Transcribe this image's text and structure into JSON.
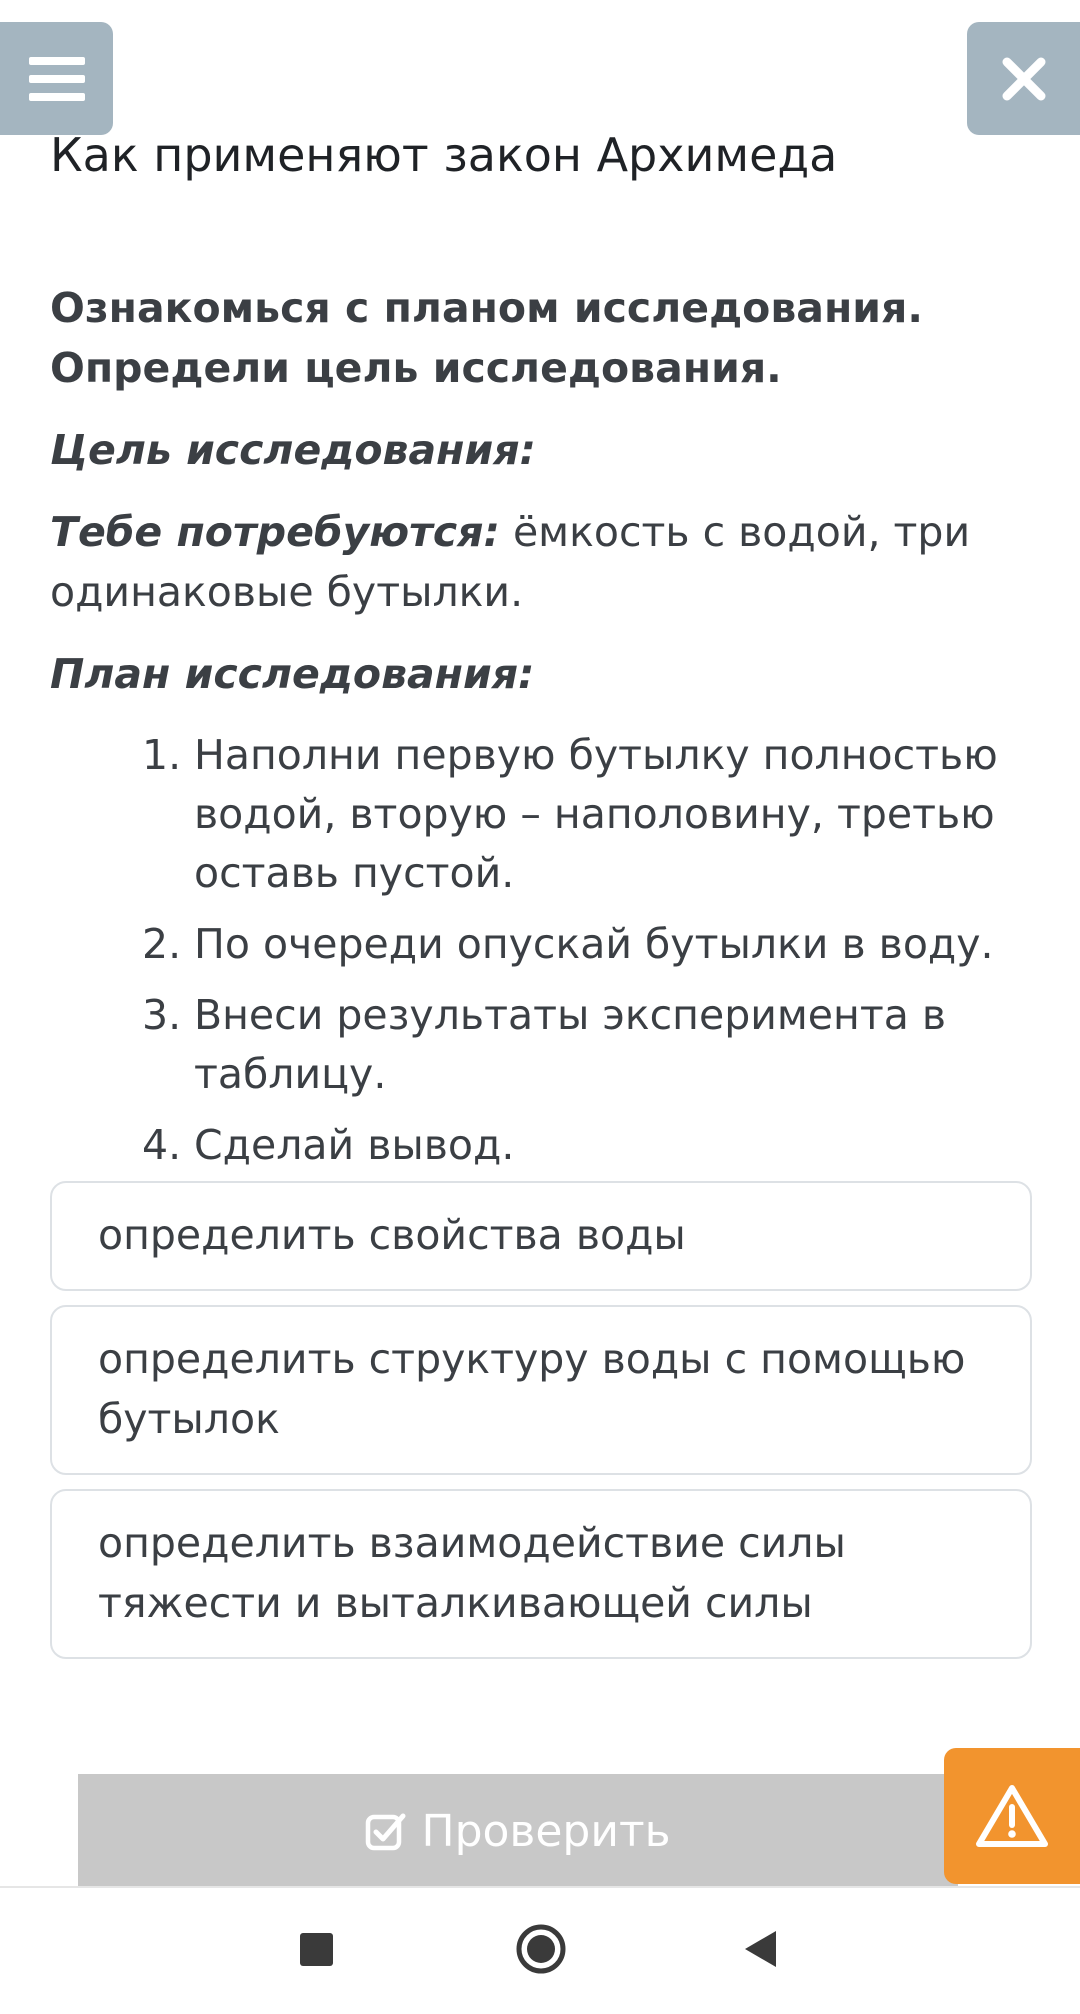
{
  "header": {
    "menu_icon": "hamburger-icon",
    "close_icon": "close-icon",
    "lesson_title": "Как применяют закон Архимеда"
  },
  "task": {
    "line1": "Ознакомься с планом исследования.",
    "line2": "Определи цель исследования.",
    "goal_label": "Цель исследования:",
    "need_label": "Тебе потребуются:",
    "need_text": " ёмкость с водой, три одинаковые бутылки.",
    "plan_label": "План исследования:",
    "plan_steps": [
      {
        "num": "1.",
        "text": "Наполни первую бутылку полностью водой, вторую – наполовину, третью оставь пустой."
      },
      {
        "num": "2.",
        "text": "По очереди опускай бутылки в воду."
      },
      {
        "num": "3.",
        "text": "Внеси результаты эксперимента в таблицу."
      },
      {
        "num": "4.",
        "text": "Сделай вывод."
      }
    ]
  },
  "options": [
    "определить свойства воды",
    "определить структуру воды с помощью бутылок",
    "определить взаимодействие силы тяжести и выталкивающей силы"
  ],
  "footer": {
    "check_label": "Проверить",
    "check_icon": "checkbox-icon",
    "warning_icon": "warning-icon"
  },
  "navbar": {
    "recent_icon": "square-icon",
    "home_icon": "circle-icon",
    "back_icon": "triangle-back-icon"
  },
  "colors": {
    "top_buttons": "#a4b5c0",
    "check_button": "#c8c8c8",
    "warning_button": "#f2942e",
    "text": "#3b3f44"
  }
}
